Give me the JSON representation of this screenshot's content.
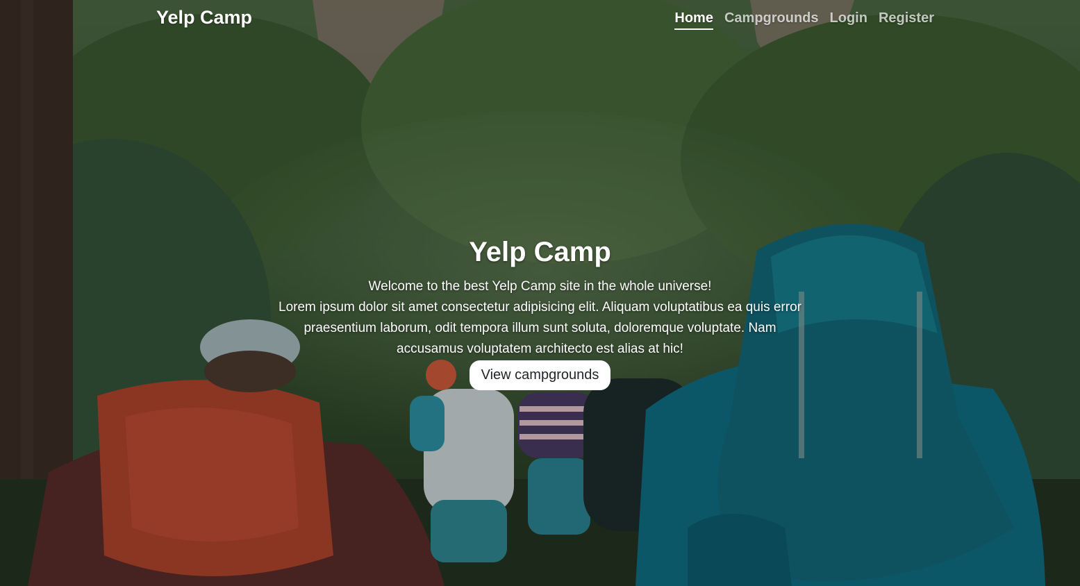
{
  "header": {
    "brand": "Yelp Camp",
    "nav": [
      {
        "label": "Home",
        "active": true
      },
      {
        "label": "Campgrounds",
        "active": false
      },
      {
        "label": "Login",
        "active": false
      },
      {
        "label": "Register",
        "active": false
      }
    ]
  },
  "hero": {
    "title": "Yelp Camp",
    "welcome": "Welcome to the best Yelp Camp site in the whole universe!",
    "body": "Lorem ipsum dolor sit amet consectetur adipisicing elit. Aliquam voluptatibus ea quis error praesentium laborum, odit tempora illum sunt soluta, doloremque voluptate. Nam accusamus voluptatem architecto est alias at hic!",
    "button_label": "View campgrounds"
  }
}
